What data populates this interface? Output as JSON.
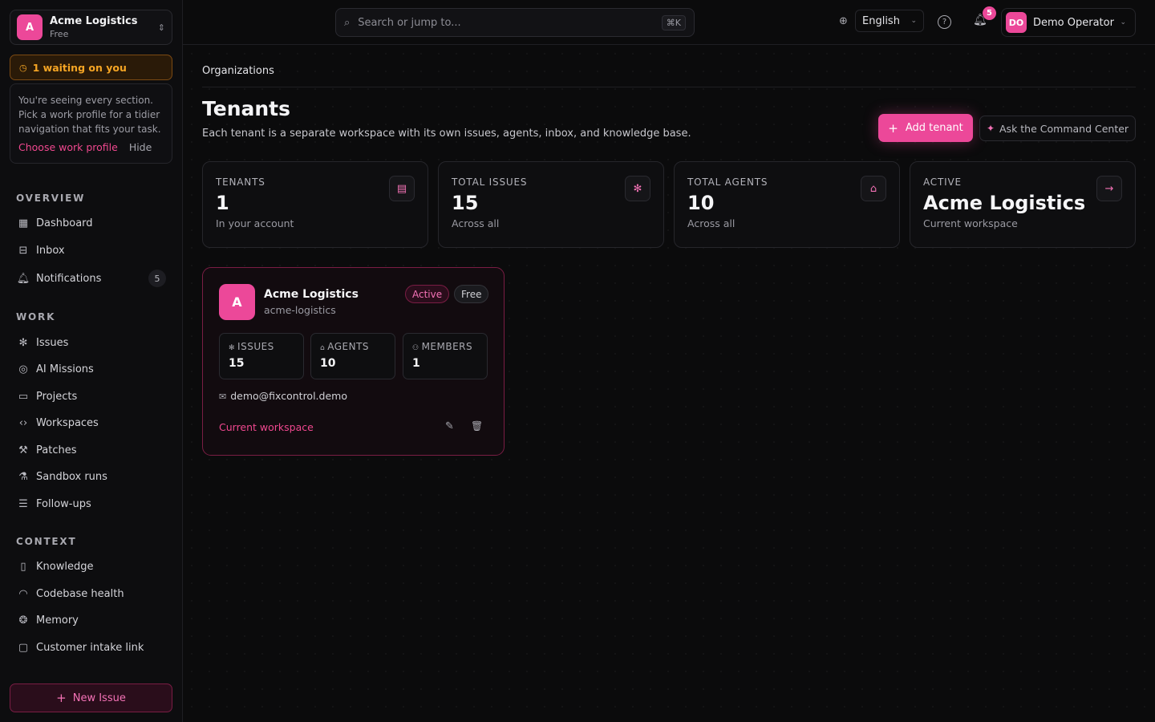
{
  "org": {
    "avatar": "A",
    "name": "Acme Logistics",
    "plan": "Free"
  },
  "waiting": {
    "text": "1 waiting on you"
  },
  "tip": {
    "text": "You're seeing every section. Pick a work profile for a tidier navigation that fits your task.",
    "primary": "Choose work profile",
    "secondary": "Hide"
  },
  "sections": {
    "overview": "OVERVIEW",
    "work": "WORK",
    "context": "CONTEXT"
  },
  "nav": {
    "dashboard": "Dashboard",
    "inbox": "Inbox",
    "notifications": "Notifications",
    "notifications_count": "5",
    "issues": "Issues",
    "ai_missions": "AI Missions",
    "projects": "Projects",
    "workspaces": "Workspaces",
    "patches": "Patches",
    "sandbox_runs": "Sandbox runs",
    "follow_ups": "Follow-ups",
    "knowledge": "Knowledge",
    "codebase_health": "Codebase health",
    "memory": "Memory",
    "customer_intake": "Customer intake link"
  },
  "new_issue": "New Issue",
  "topbar": {
    "search_placeholder": "Search or jump to...",
    "search_shortcut": "⌘K",
    "language": "English",
    "notif_count": "5",
    "user_initials": "DO",
    "user_name": "Demo Operator"
  },
  "page": {
    "breadcrumb": "Organizations",
    "title": "Tenants",
    "subtitle": "Each tenant is a separate workspace with its own issues, agents, inbox, and knowledge base.",
    "add_button": "Add tenant",
    "ask_button": "Ask the Command Center"
  },
  "stats": [
    {
      "label": "TENANTS",
      "value": "1",
      "note": "In your account"
    },
    {
      "label": "TOTAL ISSUES",
      "value": "15",
      "note": "Across all"
    },
    {
      "label": "TOTAL AGENTS",
      "value": "10",
      "note": "Across all"
    },
    {
      "label": "ACTIVE",
      "value": "Acme Logistics",
      "note": "Current workspace"
    }
  ],
  "tenant": {
    "avatar": "A",
    "name": "Acme Logistics",
    "slug": "acme-logistics",
    "status": "Active",
    "plan": "Free",
    "metrics": [
      {
        "label": "ISSUES",
        "value": "15"
      },
      {
        "label": "AGENTS",
        "value": "10"
      },
      {
        "label": "MEMBERS",
        "value": "1"
      }
    ],
    "email": "demo@fixcontrol.demo",
    "current_label": "Current workspace"
  },
  "colors": {
    "accent": "#ec4899",
    "warning": "#f5a524",
    "background": "#0b0b0c"
  }
}
